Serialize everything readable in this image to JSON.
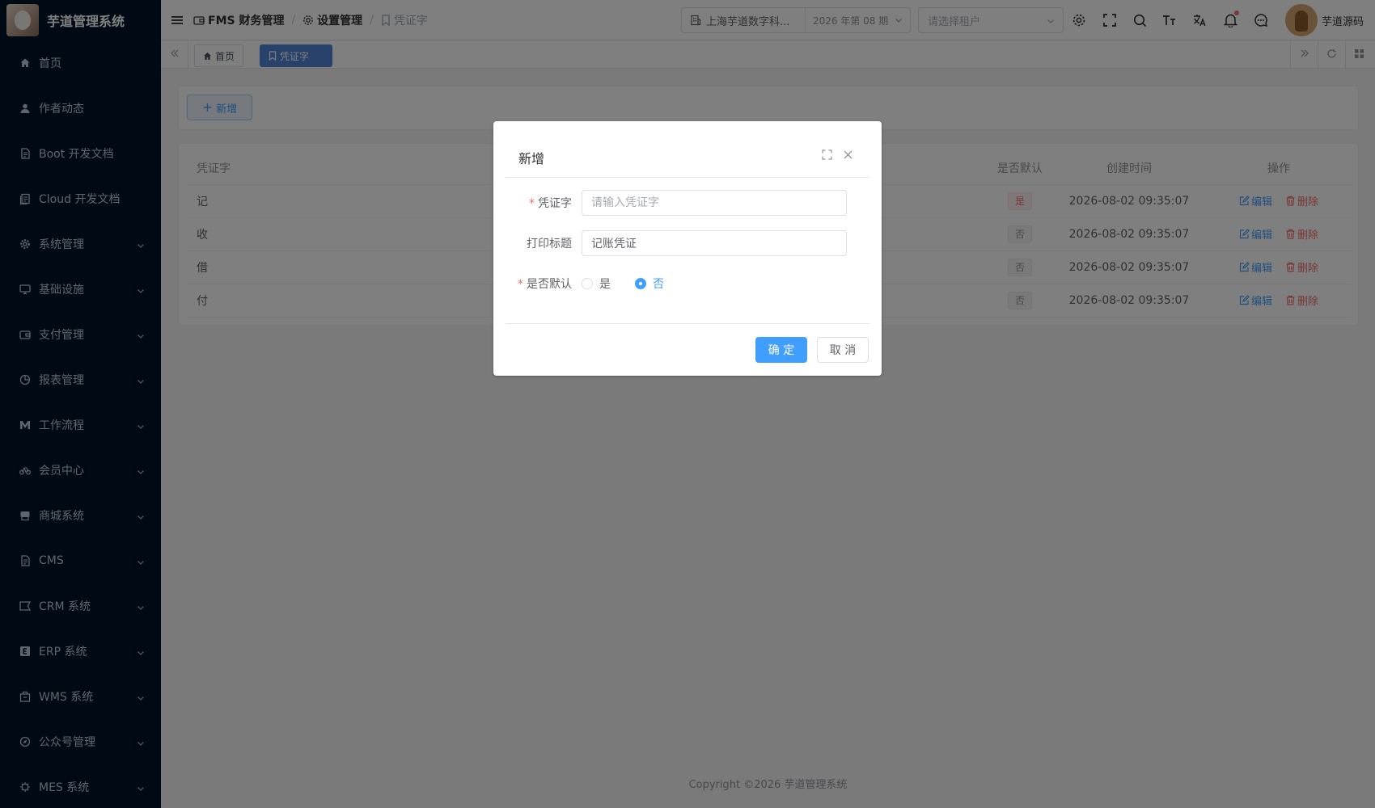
{
  "app": {
    "title": "芋道管理系统"
  },
  "sidebar": {
    "items": [
      {
        "label": "首页",
        "icon": "home-icon"
      },
      {
        "label": "作者动态",
        "icon": "user-icon"
      },
      {
        "label": "Boot 开发文档",
        "icon": "document-icon"
      },
      {
        "label": "Cloud 开发文档",
        "icon": "documents-icon"
      },
      {
        "label": "系统管理",
        "icon": "gear-icon"
      },
      {
        "label": "基础设施",
        "icon": "monitor-icon"
      },
      {
        "label": "支付管理",
        "icon": "wallet-icon"
      },
      {
        "label": "报表管理",
        "icon": "pie-chart-icon"
      },
      {
        "label": "工作流程",
        "icon": "workflow-icon"
      },
      {
        "label": "会员中心",
        "icon": "bicycle-icon"
      },
      {
        "label": "商城系统",
        "icon": "shop-icon"
      },
      {
        "label": "CMS",
        "icon": "document-icon"
      },
      {
        "label": "CRM 系统",
        "icon": "crm-icon"
      },
      {
        "label": "ERP 系统",
        "icon": "erp-icon"
      },
      {
        "label": "WMS 系统",
        "icon": "warehouse-icon"
      },
      {
        "label": "公众号管理",
        "icon": "compass-icon"
      },
      {
        "label": "MES 系统",
        "icon": "chip-icon"
      }
    ]
  },
  "header": {
    "breadcrumb": [
      "FMS 财务管理",
      "设置管理",
      "凭证字"
    ],
    "company": "上海芋道数字科...",
    "period": "2026 年第 08 期",
    "tenant_placeholder": "请选择租户",
    "username": "芋道源码"
  },
  "tags": {
    "home": "首页",
    "current": "凭证字"
  },
  "toolbar": {
    "add_label": "新增"
  },
  "table": {
    "columns": {
      "name": "凭证字",
      "is_default": "是否默认",
      "created": "创建时间",
      "actions": "操作"
    },
    "rows": [
      {
        "name": "记",
        "is_default": "是",
        "created": "2026-08-02 09:35:07"
      },
      {
        "name": "收",
        "is_default": "否",
        "created": "2026-08-02 09:35:07"
      },
      {
        "name": "借",
        "is_default": "否",
        "created": "2026-08-02 09:35:07"
      },
      {
        "name": "付",
        "is_default": "否",
        "created": "2026-08-02 09:35:07"
      }
    ],
    "edit_label": "编辑",
    "delete_label": "删除"
  },
  "footer": {
    "copyright": "Copyright ©2026 芋道管理系统"
  },
  "dialog": {
    "title": "新增",
    "fields": {
      "voucher_label": "凭证字",
      "voucher_placeholder": "请输入凭证字",
      "voucher_value": "",
      "print_title_label": "打印标题",
      "print_title_value": "记账凭证",
      "default_label": "是否默认",
      "yes": "是",
      "no": "否",
      "selected": "否"
    },
    "confirm": "确 定",
    "cancel": "取 消"
  },
  "colors": {
    "primary": "#409eff",
    "danger": "#f56c6c",
    "sidebar": "#001529"
  }
}
